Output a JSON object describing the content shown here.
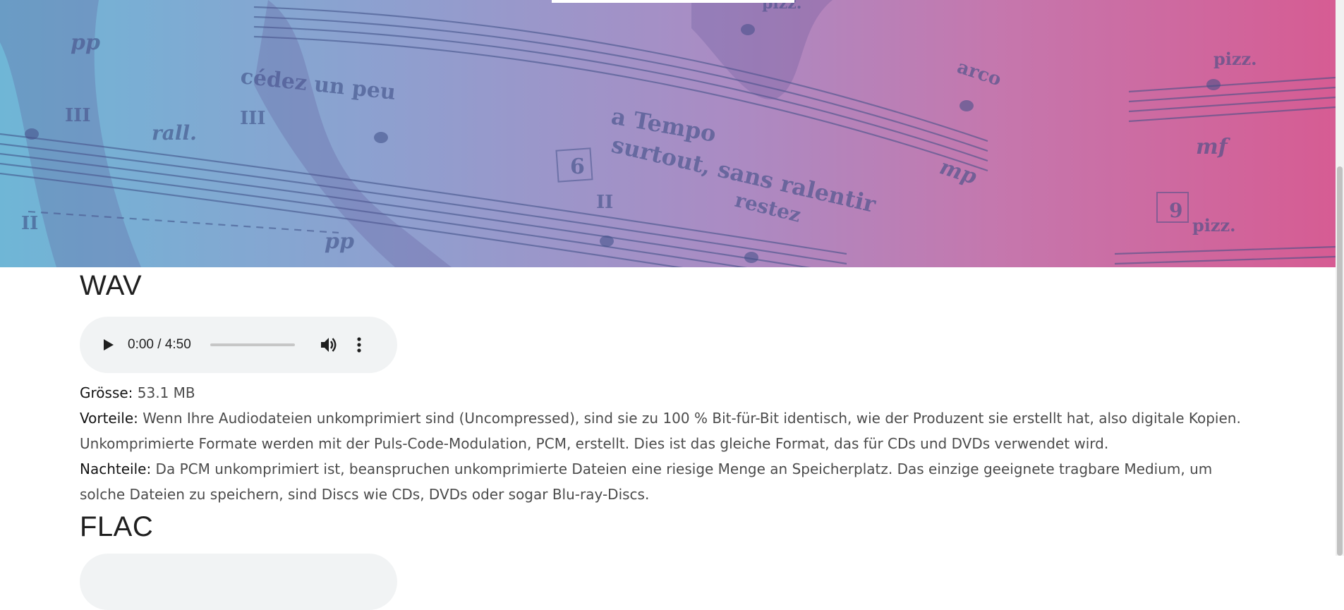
{
  "sections": [
    {
      "title": "WAV",
      "player": {
        "time": "0:00 / 4:50"
      },
      "size_label": "Grösse:",
      "size_value": " 53.1 MB",
      "pros_label": "Vorteile:",
      "pros_text": " Wenn Ihre Audiodateien unkomprimiert sind (Uncompressed), sind sie zu 100 % Bit-für-Bit identisch, wie der Produzent sie erstellt hat, also digitale Kopien. Unkomprimierte Formate werden mit der Puls-Code-Modulation, PCM, erstellt. Dies ist das gleiche Format, das für CDs und DVDs verwendet wird.",
      "cons_label": "Nachteile:",
      "cons_text": " Da PCM unkomprimiert ist, beanspruchen unkomprimierte Dateien eine riesige Menge an Speicherplatz. Das einzige geeignete tragbare Medium, um solche Dateien zu speichern, sind Discs wie CDs, DVDs oder sogar Blu-ray-Discs."
    },
    {
      "title": "FLAC"
    }
  ],
  "hero": {
    "notation_text": [
      "cédez un peu",
      "a Tempo",
      "surtout, sans ralentir",
      "restez",
      "rall.",
      "arco",
      "pizz.",
      "pizz.",
      "pizz.",
      "pp",
      "pp",
      "mp",
      "mf",
      "6",
      "9",
      "III",
      "III",
      "II",
      "II"
    ]
  },
  "colors": {
    "hero_left": "#6fb6d6",
    "hero_right": "#d65c93",
    "player_bg": "#f1f3f4",
    "heading": "#1f1f1f",
    "body_text": "#4b4b4b"
  },
  "icons": [
    "play-icon",
    "volume-icon",
    "more-vertical-icon"
  ]
}
